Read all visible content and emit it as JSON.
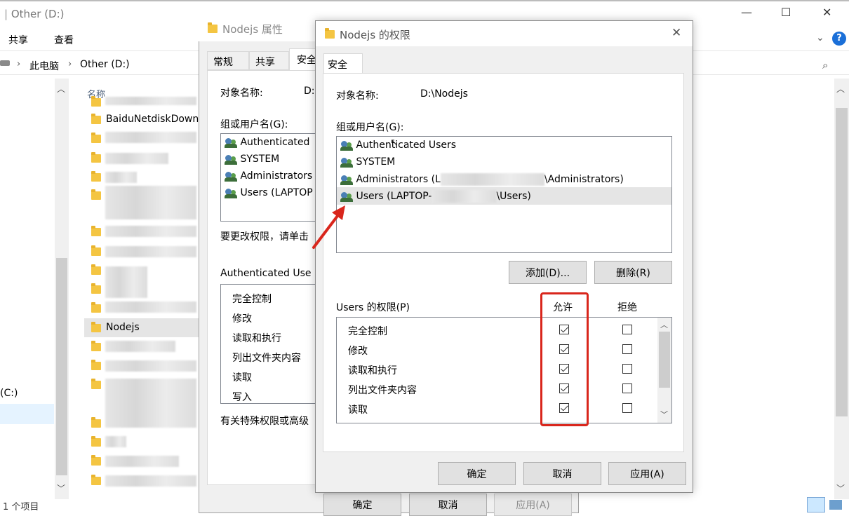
{
  "explorer": {
    "title": "Other (D:)",
    "ribbon_tabs": [
      "共享",
      "查看"
    ],
    "breadcrumb": [
      "此电脑",
      "Other (D:)"
    ],
    "column_name": "名称",
    "folders": [
      "BaiduNetdiskDownload",
      "Nodejs"
    ],
    "drive_label": "(C:)",
    "status": "1 个项目",
    "window_controls": {
      "min": "—",
      "max": "☐",
      "close": "✕"
    },
    "help": "?"
  },
  "props": {
    "title": "Nodejs 属性",
    "tabs": [
      "常规",
      "共享",
      "安全"
    ],
    "object_label": "对象名称:",
    "object_value": "D:",
    "group_label": "组或用户名(G):",
    "users": [
      "Authenticated",
      "SYSTEM",
      "Administrators",
      "Users (LAPTOP"
    ],
    "change_hint": "要更改权限，请单击",
    "perm_header": "Authenticated Use",
    "perms": [
      "完全控制",
      "修改",
      "读取和执行",
      "列出文件夹内容",
      "读取",
      "写入"
    ],
    "special_hint": "有关特殊权限或高级",
    "buttons": {
      "ok": "确定",
      "cancel": "取消",
      "apply": "应用(A)"
    }
  },
  "dialog": {
    "title": "Nodejs 的权限",
    "tab": "安全",
    "object_label": "对象名称:",
    "object_value": "D:\\Nodejs",
    "group_label": "组或用户名(G):",
    "users": [
      {
        "name": "Authenticated Users",
        "prefix": "",
        "suffix": ""
      },
      {
        "name": "SYSTEM",
        "prefix": "",
        "suffix": ""
      },
      {
        "name": "",
        "prefix": "Administrators (L",
        "suffix": "\\Administrators)"
      },
      {
        "name": "",
        "prefix": "Users (LAPTOP-",
        "suffix": "\\Users)"
      }
    ],
    "add_button": "添加(D)...",
    "remove_button": "删除(R)",
    "perm_header": "Users 的权限(P)",
    "allow_label": "允许",
    "deny_label": "拒绝",
    "perms": [
      {
        "label": "完全控制",
        "allow": true,
        "deny": false
      },
      {
        "label": "修改",
        "allow": true,
        "deny": false
      },
      {
        "label": "读取和执行",
        "allow": true,
        "deny": false
      },
      {
        "label": "列出文件夹内容",
        "allow": true,
        "deny": false
      },
      {
        "label": "读取",
        "allow": true,
        "deny": false
      }
    ],
    "buttons": {
      "ok": "确定",
      "cancel": "取消",
      "apply": "应用(A)"
    },
    "close": "✕"
  },
  "colors": {
    "highlight": "#d9261c",
    "selected_row": "#e5e5e5",
    "button": "#e1e1e1"
  }
}
